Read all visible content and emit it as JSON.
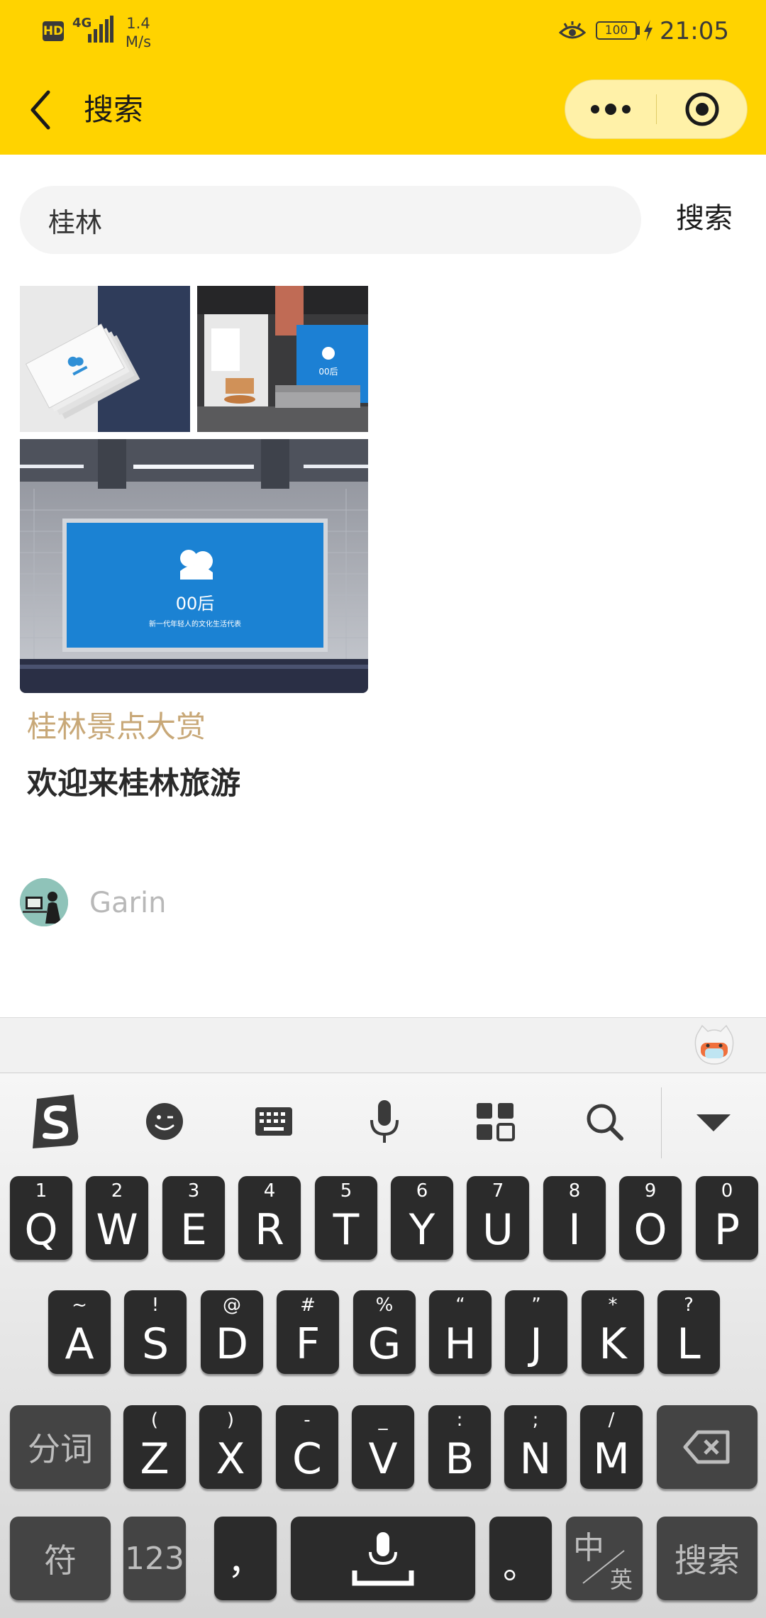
{
  "status_bar": {
    "hd": "HD",
    "network": "4G",
    "speed_value": "1.4",
    "speed_unit": "M/s",
    "battery": "100",
    "time": "21:05"
  },
  "header": {
    "title": "搜索"
  },
  "search": {
    "value": "桂林",
    "button_label": "搜索"
  },
  "result": {
    "subtitle": "桂林景点大赏",
    "title": "欢迎来桂林旅游",
    "author": "Garin",
    "image_text": {
      "brand": "00后",
      "slogan": "新一代年轻人的文化生活代表"
    }
  },
  "keyboard": {
    "toolbar": [
      "sogou-logo-icon",
      "emoji-icon",
      "keyboard-icon",
      "microphone-icon",
      "apps-grid-icon",
      "search-icon",
      "collapse-icon"
    ],
    "row1": [
      {
        "k": "Q",
        "s": "1"
      },
      {
        "k": "W",
        "s": "2"
      },
      {
        "k": "E",
        "s": "3"
      },
      {
        "k": "R",
        "s": "4"
      },
      {
        "k": "T",
        "s": "5"
      },
      {
        "k": "Y",
        "s": "6"
      },
      {
        "k": "U",
        "s": "7"
      },
      {
        "k": "I",
        "s": "8"
      },
      {
        "k": "O",
        "s": "9"
      },
      {
        "k": "P",
        "s": "0"
      }
    ],
    "row2": [
      {
        "k": "A",
        "s": "~"
      },
      {
        "k": "S",
        "s": "!"
      },
      {
        "k": "D",
        "s": "@"
      },
      {
        "k": "F",
        "s": "#"
      },
      {
        "k": "G",
        "s": "%"
      },
      {
        "k": "H",
        "s": "“"
      },
      {
        "k": "J",
        "s": "”"
      },
      {
        "k": "K",
        "s": "*"
      },
      {
        "k": "L",
        "s": "?"
      }
    ],
    "row3": [
      {
        "k": "Z",
        "s": "("
      },
      {
        "k": "X",
        "s": ")"
      },
      {
        "k": "C",
        "s": "-"
      },
      {
        "k": "V",
        "s": "_"
      },
      {
        "k": "B",
        "s": ":"
      },
      {
        "k": "N",
        "s": ";"
      },
      {
        "k": "M",
        "s": "/"
      }
    ],
    "fenci": "分词",
    "fu": "符",
    "num": "123",
    "comma": "，",
    "period": "。",
    "lang_top": "中",
    "lang_bottom": "英",
    "enter": "搜索"
  },
  "colors": {
    "header_bg": "#FFD300",
    "capsule_bg": "#FFF1A8",
    "subtitle": "#C8A878",
    "author": "#B8B8B8",
    "key_bg": "#2B2B2B",
    "fn_key_bg": "#444444"
  }
}
